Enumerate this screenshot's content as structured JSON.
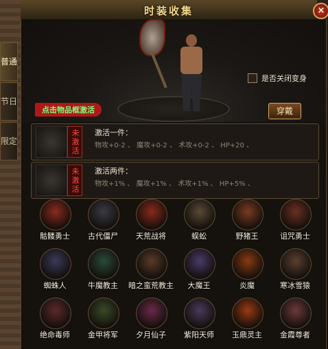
{
  "window": {
    "title": "时装收集",
    "close_label": "×"
  },
  "side_tabs": [
    {
      "label": "普通",
      "active": true
    },
    {
      "label": "节日",
      "active": false
    },
    {
      "label": "限定",
      "active": false
    }
  ],
  "preview": {
    "toggle_label": "是否关闭变身",
    "hint_label": "点击物品框激活",
    "wear_button": "穿戴"
  },
  "sets": [
    {
      "status": "未激活",
      "title": "激活一件：",
      "stats": "物攻+0-2 、 魔攻+0-2 、 术攻+0-2 、 HP+20 、"
    },
    {
      "status": "未激活",
      "title": "激活两件：",
      "stats": "物攻+1% 、 魔攻+1% 、 术攻+1% 、 HP+5% 、"
    }
  ],
  "costumes": [
    {
      "name": "骷髅勇士",
      "color": "#8a2a20"
    },
    {
      "name": "古代僵尸",
      "color": "#3a3a44"
    },
    {
      "name": "天荒战将",
      "color": "#8a2a1c"
    },
    {
      "name": "蜈蚣",
      "color": "#5a4a34"
    },
    {
      "name": "野猪王",
      "color": "#7a3a22"
    },
    {
      "name": "诅咒勇士",
      "color": "#6a3024"
    },
    {
      "name": "蜘蛛人",
      "color": "#3a3a5a"
    },
    {
      "name": "牛魔教主",
      "color": "#2a4a3a"
    },
    {
      "name": "暗之蛮荒教主",
      "color": "#5a3a2a"
    },
    {
      "name": "大魔王",
      "color": "#4a3a6a"
    },
    {
      "name": "炎魔",
      "color": "#8a3a10"
    },
    {
      "name": "寒冰雪猿",
      "color": "#5a4030"
    },
    {
      "name": "绝命毒师",
      "color": "#5a2a2a"
    },
    {
      "name": "金甲将军",
      "color": "#3a4a2a"
    },
    {
      "name": "夕月仙子",
      "color": "#6a2a4a"
    },
    {
      "name": "紫阳天师",
      "color": "#4a3a5a"
    },
    {
      "name": "玉鼎灵主",
      "color": "#9a3a10"
    },
    {
      "name": "金霞尊者",
      "color": "#6a3a3a"
    }
  ]
}
